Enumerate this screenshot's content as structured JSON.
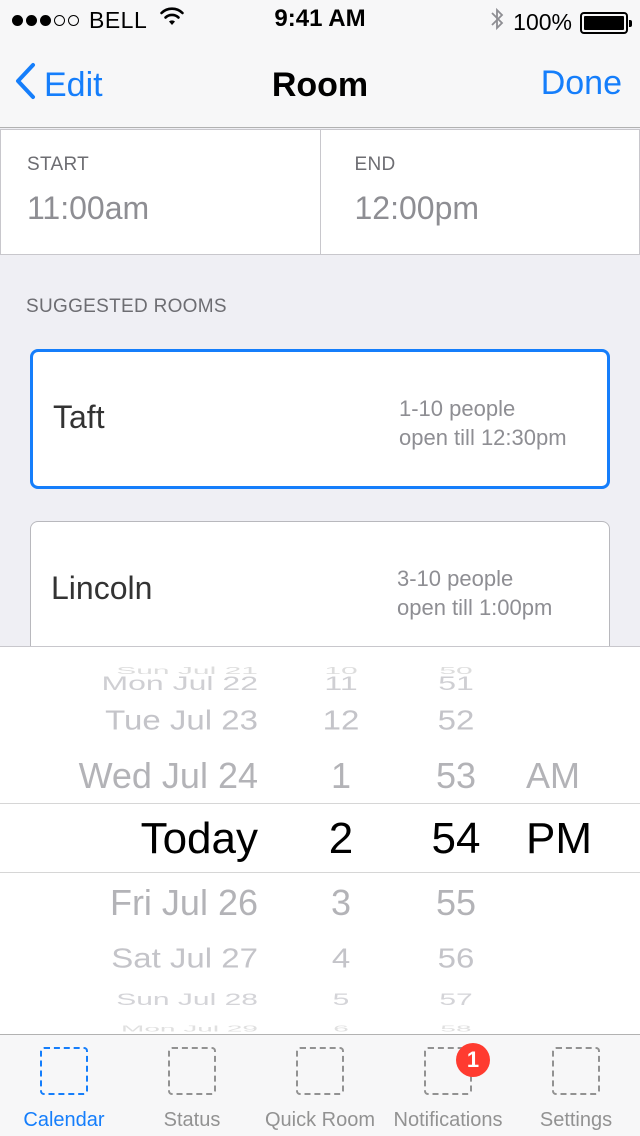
{
  "status_bar": {
    "carrier": "BELL",
    "time": "9:41 AM",
    "battery": "100%",
    "signal_bars_filled": 3,
    "signal_bars_total": 5
  },
  "nav": {
    "back_label": "Edit",
    "title": "Room",
    "done_label": "Done"
  },
  "time_range": {
    "start_label": "START",
    "start_value": "11:00am",
    "end_label": "END",
    "end_value": "12:00pm"
  },
  "suggested": {
    "header": "SUGGESTED ROOMS",
    "rooms": [
      {
        "name": "Taft",
        "capacity": "1-10 people",
        "availability": "open till 12:30pm",
        "selected": true
      },
      {
        "name": "Lincoln",
        "capacity": "3-10 people",
        "availability": "open till 1:00pm",
        "selected": false
      }
    ]
  },
  "picker": {
    "rows": [
      {
        "day": "Sun Jul 21",
        "hour": "10",
        "minute": "50",
        "ampm": ""
      },
      {
        "day": "Mon Jul 22",
        "hour": "11",
        "minute": "51",
        "ampm": ""
      },
      {
        "day": "Tue Jul 23",
        "hour": "12",
        "minute": "52",
        "ampm": ""
      },
      {
        "day": "Wed Jul 24",
        "hour": "1",
        "minute": "53",
        "ampm": "AM"
      },
      {
        "day": "Today",
        "hour": "2",
        "minute": "54",
        "ampm": "PM"
      },
      {
        "day": "Fri Jul 26",
        "hour": "3",
        "minute": "55",
        "ampm": ""
      },
      {
        "day": "Sat Jul 27",
        "hour": "4",
        "minute": "56",
        "ampm": ""
      },
      {
        "day": "Sun Jul 28",
        "hour": "5",
        "minute": "57",
        "ampm": ""
      },
      {
        "day": "Mon Jul 29",
        "hour": "6",
        "minute": "58",
        "ampm": ""
      }
    ]
  },
  "tabs": [
    {
      "label": "Calendar",
      "active": true,
      "badge": ""
    },
    {
      "label": "Status",
      "active": false,
      "badge": ""
    },
    {
      "label": "Quick Room",
      "active": false,
      "badge": ""
    },
    {
      "label": "Notifications",
      "active": false,
      "badge": "1"
    },
    {
      "label": "Settings",
      "active": false,
      "badge": ""
    }
  ],
  "colors": {
    "accent": "#157efb",
    "badge": "#ff3b30",
    "background": "#efeff4"
  }
}
